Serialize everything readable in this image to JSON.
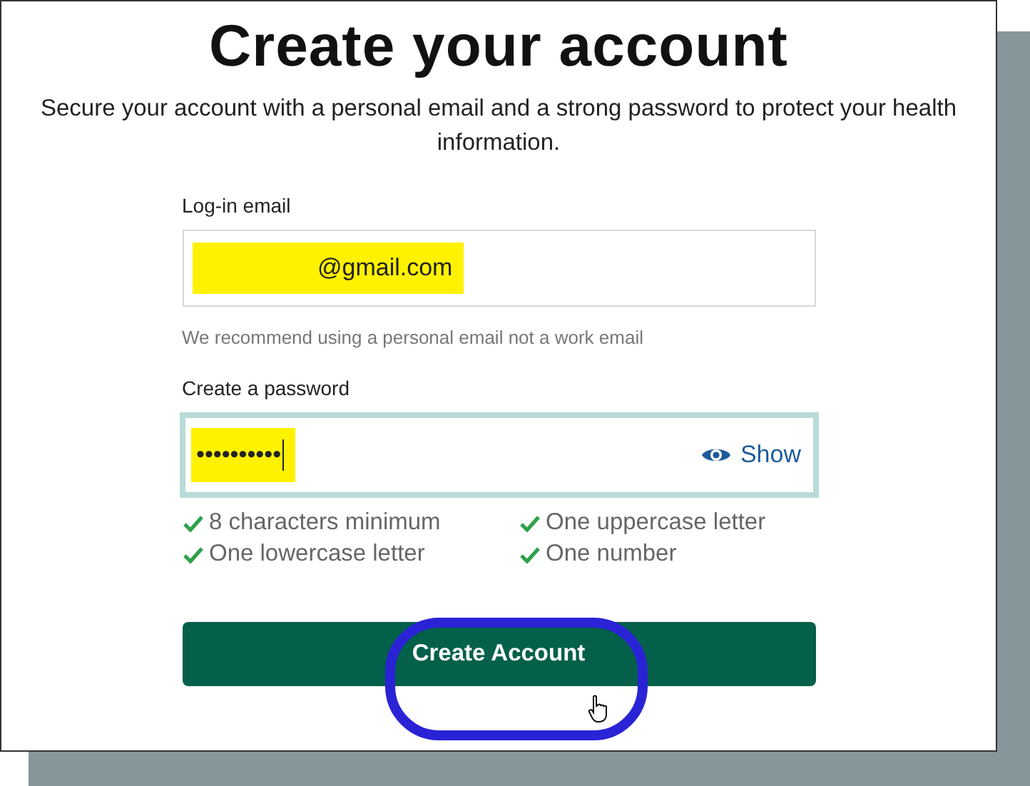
{
  "title": "Create your account",
  "subtitle": "Secure your account with a personal email and a strong password to protect your health information.",
  "email": {
    "label": "Log-in email",
    "value": "@gmail.com",
    "highlighted": true,
    "hint": "We recommend using a personal email not a work email"
  },
  "password": {
    "label": "Create a password",
    "value": "••••••••••",
    "highlighted": true,
    "focused": true,
    "toggle": "Show"
  },
  "requirements": [
    {
      "text": "8 characters minimum",
      "met": true
    },
    {
      "text": "One uppercase letter",
      "met": true
    },
    {
      "text": "One lowercase letter",
      "met": true
    },
    {
      "text": "One number",
      "met": true
    }
  ],
  "button": {
    "label": "Create Account",
    "circled": true
  }
}
